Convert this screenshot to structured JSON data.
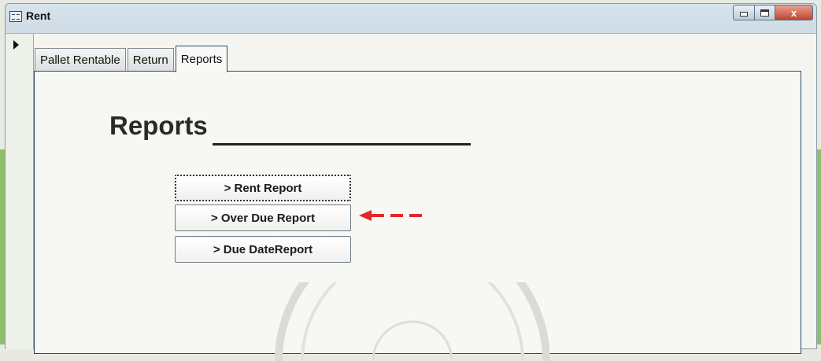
{
  "window": {
    "title": "Rent",
    "close_label": "x"
  },
  "tabs": [
    {
      "label": "Pallet Rentable"
    },
    {
      "label": "Return"
    },
    {
      "label": "Reports"
    }
  ],
  "reports_page": {
    "heading": "Reports",
    "buttons": [
      {
        "label": "> Rent Report"
      },
      {
        "label": "> Over Due Report"
      },
      {
        "label": "> Due DateReport"
      }
    ]
  },
  "colors": {
    "annotation_arrow": "#e3262b",
    "tab_border": "#2c4b6a",
    "desktop_green": "#8dbf6a"
  },
  "icons": {
    "title_icon": "form-icon",
    "record_selector": "record-selector-arrow-icon",
    "annotation": "red-dashed-arrow-icon"
  }
}
